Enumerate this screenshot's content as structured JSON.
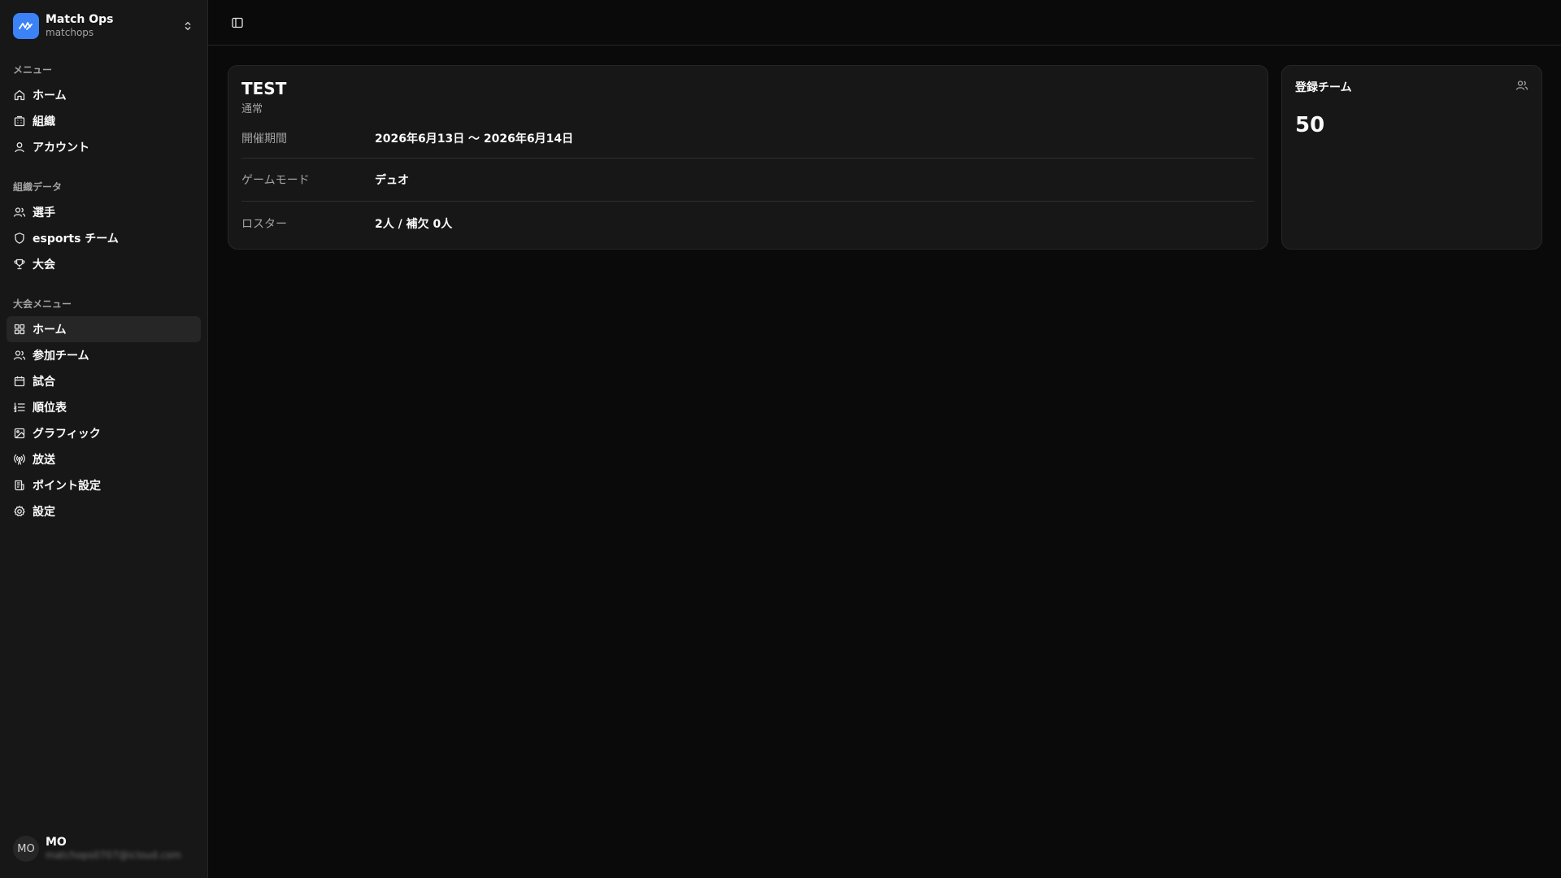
{
  "org": {
    "name": "Match Ops",
    "slug": "matchops"
  },
  "sidebar": {
    "groups": [
      {
        "label": "メニュー",
        "items": [
          {
            "label": "ホーム",
            "icon": "home-icon"
          },
          {
            "label": "組織",
            "icon": "building-icon"
          },
          {
            "label": "アカウント",
            "icon": "user-icon"
          }
        ]
      },
      {
        "label": "組織データ",
        "items": [
          {
            "label": "選手",
            "icon": "users-icon"
          },
          {
            "label": "esports チーム",
            "icon": "shield-icon"
          },
          {
            "label": "大会",
            "icon": "trophy-icon"
          }
        ]
      },
      {
        "label": "大会メニュー",
        "items": [
          {
            "label": "ホーム",
            "icon": "layout-grid-icon",
            "active": true
          },
          {
            "label": "参加チーム",
            "icon": "users-icon"
          },
          {
            "label": "試合",
            "icon": "calendar-icon"
          },
          {
            "label": "順位表",
            "icon": "list-ordered-icon"
          },
          {
            "label": "グラフィック",
            "icon": "image-icon"
          },
          {
            "label": "放送",
            "icon": "broadcast-icon"
          },
          {
            "label": "ポイント設定",
            "icon": "receipt-icon"
          },
          {
            "label": "設定",
            "icon": "gear-icon"
          }
        ]
      }
    ]
  },
  "user": {
    "initials": "MO",
    "name": "MO",
    "email": "matchops0707@icloud.com"
  },
  "event": {
    "title": "TEST",
    "subtitle": "通常",
    "rows": [
      {
        "label": "開催期間",
        "value": "2026年6月13日 〜 2026年6月14日"
      },
      {
        "label": "ゲームモード",
        "value": "デュオ"
      },
      {
        "label": "ロスター",
        "value": "2人 / 補欠 0人"
      }
    ]
  },
  "stats": {
    "registered_teams_label": "登録チーム",
    "registered_teams_value": "50"
  },
  "colors": {
    "accent": "#3b82f6",
    "background": "#0a0a0a",
    "sidebar": "#171717"
  }
}
